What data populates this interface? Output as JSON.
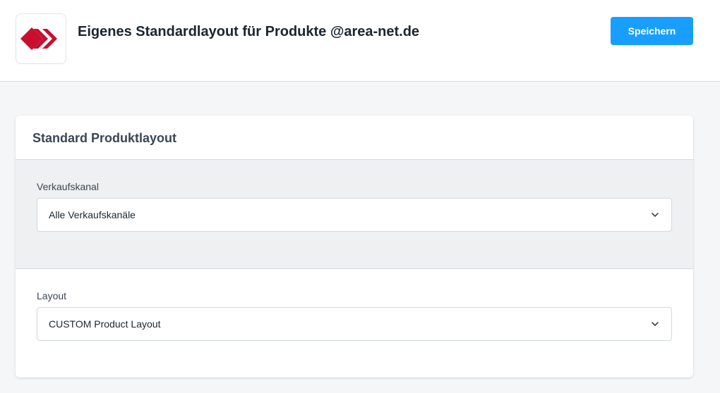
{
  "header": {
    "title": "Eigenes Standardlayout für Produkte @area-net.de",
    "save_label": "Speichern",
    "logo_icon": "area-net-logo-icon",
    "brand_color": "#c8102e",
    "accent_color": "#189eff"
  },
  "card": {
    "title": "Standard Produktlayout",
    "fields": {
      "sales_channel": {
        "label": "Verkaufskanal",
        "value": "Alle Verkaufskanäle",
        "icon": "chevron-down-icon"
      },
      "layout": {
        "label": "Layout",
        "value": "CUSTOM Product Layout",
        "icon": "chevron-down-icon"
      }
    }
  }
}
